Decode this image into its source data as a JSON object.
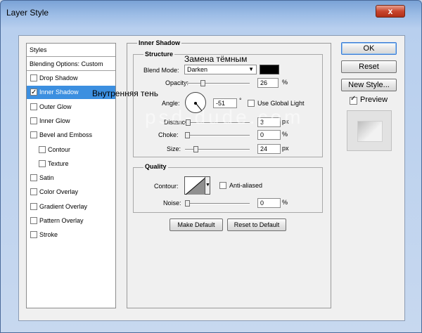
{
  "window": {
    "title": "Layer Style",
    "close_glyph": "x"
  },
  "list": {
    "header": "Styles",
    "blending": "Blending Options: Custom",
    "items": [
      {
        "label": "Drop Shadow",
        "checked": false,
        "sub": false
      },
      {
        "label": "Inner Shadow",
        "checked": true,
        "sub": false,
        "selected": true
      },
      {
        "label": "Outer Glow",
        "checked": false,
        "sub": false
      },
      {
        "label": "Inner Glow",
        "checked": false,
        "sub": false
      },
      {
        "label": "Bevel and Emboss",
        "checked": false,
        "sub": false
      },
      {
        "label": "Contour",
        "checked": false,
        "sub": true
      },
      {
        "label": "Texture",
        "checked": false,
        "sub": true
      },
      {
        "label": "Satin",
        "checked": false,
        "sub": false
      },
      {
        "label": "Color Overlay",
        "checked": false,
        "sub": false
      },
      {
        "label": "Gradient Overlay",
        "checked": false,
        "sub": false
      },
      {
        "label": "Pattern Overlay",
        "checked": false,
        "sub": false
      },
      {
        "label": "Stroke",
        "checked": false,
        "sub": false
      }
    ]
  },
  "panel": {
    "title": "Inner Shadow",
    "structure": {
      "title": "Structure",
      "blend_mode_label": "Blend Mode:",
      "blend_mode_value": "Darken",
      "opacity_label": "Opacity:",
      "opacity_value": "26",
      "angle_label": "Angle:",
      "angle_value": "-51",
      "degree": "°",
      "use_global_light": "Use Global Light",
      "distance_label": "Distance:",
      "distance_value": "3",
      "choke_label": "Choke:",
      "choke_value": "0",
      "size_label": "Size:",
      "size_value": "24",
      "unit_px": "px",
      "unit_pct": "%",
      "shadow_color": "#000000"
    },
    "quality": {
      "title": "Quality",
      "contour_label": "Contour:",
      "anti_aliased": "Anti-aliased",
      "noise_label": "Noise:",
      "noise_value": "0"
    },
    "make_default": "Make Default",
    "reset_to_default": "Reset to Default"
  },
  "right": {
    "ok": "OK",
    "reset": "Reset",
    "new_style": "New Style...",
    "preview": "Preview"
  },
  "annotations": {
    "dark_replace": "Замена тёмным",
    "inner_shadow": "Внутренняя тень"
  },
  "watermark": "psd-dude.com"
}
